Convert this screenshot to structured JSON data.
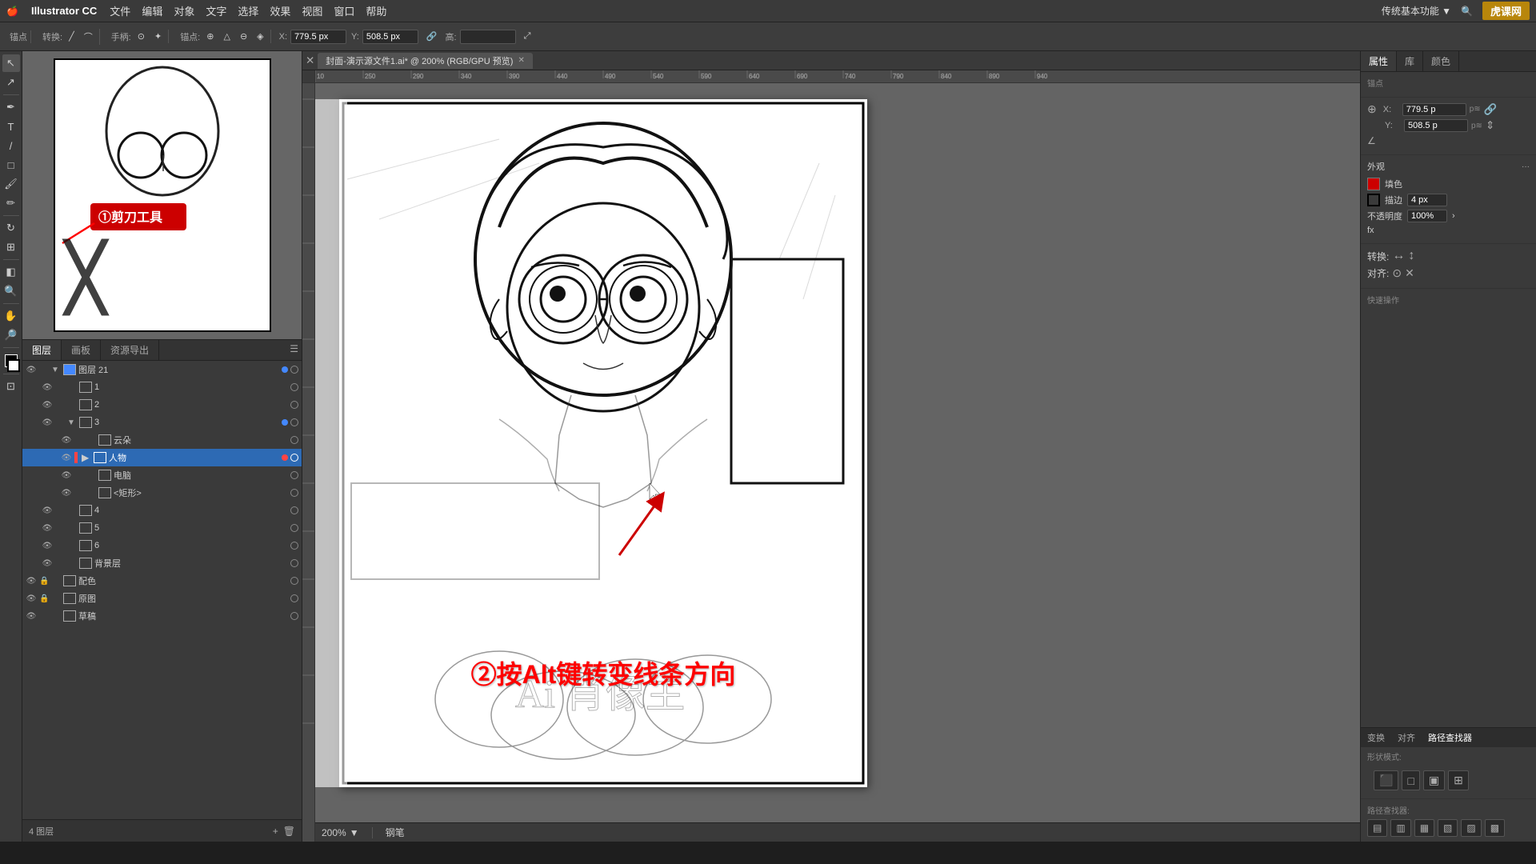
{
  "app": {
    "name": "Illustrator CC",
    "title": "封面-演示源文件1.ai* @ 200% (RGB/GPU 预览)"
  },
  "menu": {
    "apple": "🍎",
    "items": [
      "文件",
      "编辑",
      "对象",
      "文字",
      "选择",
      "效果",
      "视图",
      "窗口",
      "帮助"
    ]
  },
  "toolbar": {
    "anchor_label": "锚点",
    "convert_label": "转换:",
    "pen_label": "手柄:",
    "anchor2_label": "锚点:",
    "x_label": "X:",
    "x_value": "779.5 px",
    "y_label": "Y:",
    "y_value": "508.5 px",
    "height_label": "高:"
  },
  "tab": {
    "label": "封面-演示源文件1.ai* @ 200% (RGB/GPU 预览)"
  },
  "layers": {
    "panel_tabs": [
      "图层",
      "画板",
      "资源导出"
    ],
    "items": [
      {
        "name": "图层 21",
        "level": 0,
        "expanded": true,
        "color": "#4488ff",
        "has_eye": true,
        "has_expand": true
      },
      {
        "name": "1",
        "level": 1,
        "icon": "img",
        "color": "#ff4444",
        "has_eye": true
      },
      {
        "name": "2",
        "level": 1,
        "icon": "img",
        "color": "#ff4444",
        "has_eye": true
      },
      {
        "name": "3",
        "level": 1,
        "expanded": true,
        "color": "#ff4444",
        "has_eye": true,
        "has_expand": true
      },
      {
        "name": "云朵",
        "level": 2,
        "icon": "img",
        "color": "#ff4444",
        "has_eye": true
      },
      {
        "name": "人物",
        "level": 2,
        "icon": "img",
        "color": "#ff4444",
        "has_eye": true,
        "active": true
      },
      {
        "name": "电脑",
        "level": 2,
        "icon": "img",
        "color": "#ff4444",
        "has_eye": true
      },
      {
        "name": "<矩形>",
        "level": 2,
        "icon": "img",
        "color": "#ff4444",
        "has_eye": true
      },
      {
        "name": "4",
        "level": 1,
        "icon": "img",
        "color": "#ff4444",
        "has_eye": true
      },
      {
        "name": "5",
        "level": 1,
        "icon": "img",
        "color": "#ff4444",
        "has_eye": true
      },
      {
        "name": "6",
        "level": 1,
        "icon": "img",
        "color": "#ff4444",
        "has_eye": true
      },
      {
        "name": "背景层",
        "level": 1,
        "icon": "img",
        "color": "#ff4444",
        "has_eye": true
      },
      {
        "name": "配色",
        "level": 0,
        "icon": "img",
        "color": "#ffaa00",
        "has_eye": true,
        "locked": true
      },
      {
        "name": "原图",
        "level": 0,
        "icon": "img",
        "color": "#ffaa00",
        "has_eye": true,
        "locked": true
      },
      {
        "name": "草稿",
        "level": 0,
        "icon": "img",
        "color": "#ffaa00",
        "has_eye": true
      }
    ],
    "footer": "4 图层"
  },
  "right_panel": {
    "tabs": [
      "属性",
      "库",
      "颜色"
    ],
    "anchor_label": "锚点",
    "x_label": "X:",
    "x_value": "779.5 p",
    "y_label": "Y:",
    "y_value": "508.5 p",
    "appearance_label": "外观",
    "fill_label": "填色",
    "stroke_label": "描边",
    "stroke_width": "4 px",
    "opacity_label": "不透明度",
    "opacity_value": "100%",
    "fx_label": "fx",
    "transform_label": "转换:",
    "align_label": "对齐:",
    "quick_actions_label": "快速操作",
    "bottom_tabs": [
      "变换",
      "对齐",
      "路径查找器"
    ],
    "shape_mode_label": "形状模式:",
    "path_finder_label": "路径查找器:"
  },
  "annotations": {
    "box_text": "①剪刀工具",
    "arrow_text": "②按Alt键转变线条方向"
  },
  "status": {
    "zoom": "200%",
    "tool": "钢笔"
  },
  "brand": "虎课网"
}
